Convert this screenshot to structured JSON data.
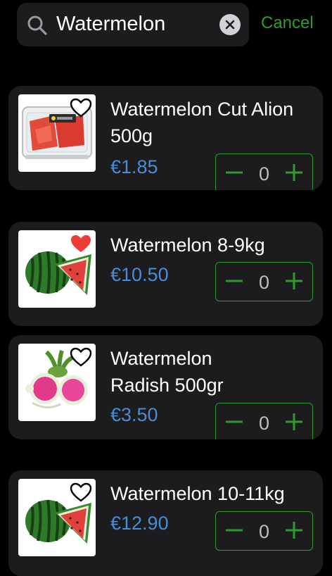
{
  "search": {
    "value": "Watermelon",
    "cancel_label": "Cancel"
  },
  "colors": {
    "accent": "#2e9b2e",
    "price": "#4a8cd6",
    "card_bg": "#1c1c1e",
    "favorite": "#ef3b36"
  },
  "products": [
    {
      "name": "Watermelon Cut Alion 500g",
      "price": "€1.85",
      "quantity": "0",
      "favorite": false,
      "image": "packaged-watermelon-slices"
    },
    {
      "name": "Watermelon 8-9kg",
      "price": "€10.50",
      "quantity": "0",
      "favorite": true,
      "image": "watermelon-whole-and-slice"
    },
    {
      "name": "Watermelon Radish 500gr",
      "price": "€3.50",
      "quantity": "0",
      "favorite": false,
      "image": "watermelon-radish"
    },
    {
      "name": "Watermelon 10-11kg",
      "price": "€12.90",
      "quantity": "0",
      "favorite": false,
      "image": "watermelon-whole-and-slice"
    }
  ]
}
